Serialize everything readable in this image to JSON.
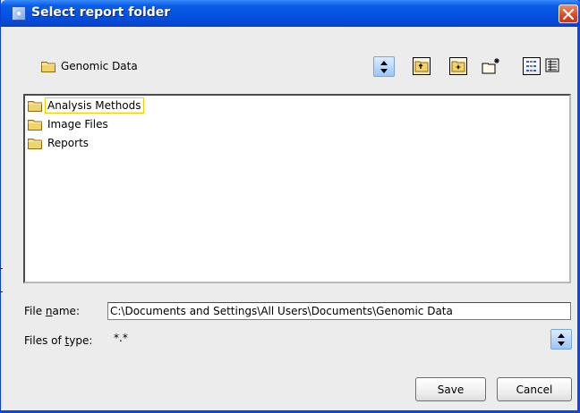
{
  "window": {
    "title": "Select report folder"
  },
  "look_in": {
    "value": "Genomic Data"
  },
  "toolbar": {
    "up_folder": "up-one-level",
    "home": "home-folder",
    "new_folder": "new-folder",
    "list_view": "list-view",
    "details_view": "details-view"
  },
  "files": [
    {
      "name": "Analysis Methods",
      "selected": true
    },
    {
      "name": "Image Files",
      "selected": false
    },
    {
      "name": "Reports",
      "selected": false
    }
  ],
  "file_name": {
    "label_pre": "File ",
    "label_mnemonic": "n",
    "label_post": "ame:",
    "value": "C:\\Documents and Settings\\All Users\\Documents\\Genomic Data"
  },
  "files_of_type": {
    "label_pre": "Files of ",
    "label_mnemonic": "t",
    "label_post": "ype:",
    "value": "*.*"
  },
  "buttons": {
    "save": "Save",
    "cancel": "Cancel"
  },
  "colors": {
    "title_bar": "#0b5ee8",
    "close": "#d9481f",
    "folder": "#f2d36a",
    "selection": "#e5d000"
  }
}
